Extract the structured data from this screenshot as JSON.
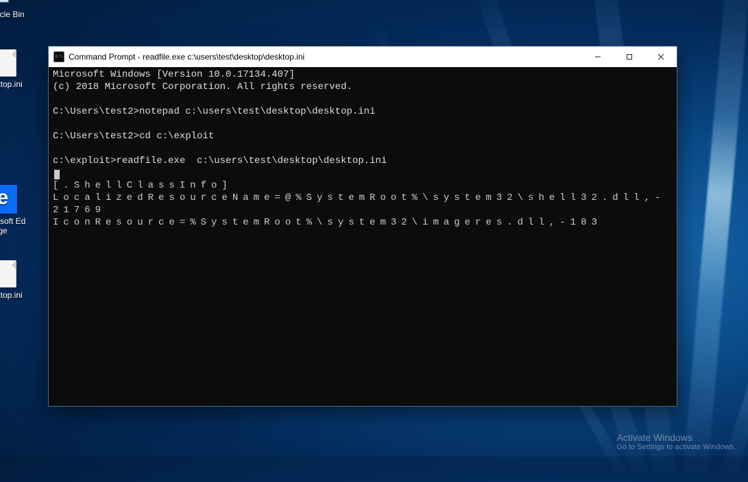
{
  "desktop": {
    "icons": [
      {
        "name": "recycle-bin",
        "label": "Recycle Bin"
      },
      {
        "name": "desktop-ini-1",
        "label": "desktop.ini"
      },
      {
        "name": "edge",
        "label": "Microsoft Edge"
      },
      {
        "name": "desktop-ini-2",
        "label": "desktop.ini"
      }
    ]
  },
  "window": {
    "title": "Command Prompt - readfile.exe  c:\\users\\test\\desktop\\desktop.ini",
    "buttons": {
      "min": "Minimize",
      "max": "Maximize",
      "close": "Close"
    }
  },
  "terminal": {
    "banner1": "Microsoft Windows [Version 10.0.17134.407]",
    "banner2": "(c) 2018 Microsoft Corporation. All rights reserved.",
    "prompt1": "C:\\Users\\test2>",
    "cmd1": "notepad c:\\users\\test\\desktop\\desktop.ini",
    "prompt2": "C:\\Users\\test2>",
    "cmd2": "cd c:\\exploit",
    "prompt3": "c:\\exploit>",
    "cmd3": "readfile.exe  c:\\users\\test\\desktop\\desktop.ini",
    "out1": "[.ShellClassInfo]",
    "out2": "LocalizedResourceName=@%SystemRoot%\\system32\\shell32.dll,-21769",
    "out3": "IconResource=%SystemRoot%\\system32\\imageres.dll,-183"
  },
  "watermark": {
    "line1": "Activate Windows",
    "line2": "Go to Settings to activate Windows."
  }
}
